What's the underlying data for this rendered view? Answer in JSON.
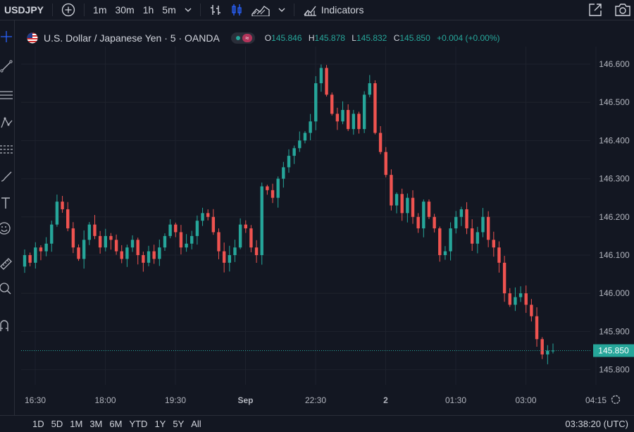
{
  "toolbar": {
    "symbol": "USDJPY",
    "intervals": [
      "1m",
      "30m",
      "1h",
      "5m"
    ],
    "active_interval": "5m",
    "indicators_label": "Indicators"
  },
  "legend": {
    "title": "U.S. Dollar / Japanese Yen · 5 · OANDA",
    "open_key": "O",
    "open": "145.846",
    "high_key": "H",
    "high": "145.878",
    "low_key": "L",
    "low": "145.832",
    "close_key": "C",
    "close": "145.850",
    "change": "+0.004 (+0.00%)"
  },
  "bottom": {
    "ranges": [
      "1D",
      "5D",
      "1M",
      "3M",
      "6M",
      "YTD",
      "1Y",
      "5Y",
      "All"
    ],
    "clock": "03:38:20 (UTC)"
  },
  "colors": {
    "up": "#26a69a",
    "down": "#ef5350",
    "background": "#131722",
    "grid": "#1e222d",
    "text": "#b2b5be",
    "interval_active": "#2962ff"
  },
  "icons": [
    "plus-circle-icon",
    "chevron-down-icon",
    "bar-style-icon",
    "candles-icon",
    "area-chart-icon",
    "indicators-icon",
    "snapshot-icon",
    "camera-icon",
    "crosshair-icon",
    "trend-line-icon",
    "fib-icon",
    "pattern-icon",
    "measure-icon",
    "text-icon",
    "emoji-icon",
    "ruler-icon",
    "zoom-icon",
    "magnet-icon",
    "settings-icon",
    "us-flag-icon"
  ],
  "chart_data": {
    "type": "candlestick",
    "y_ticks": [
      "146.600",
      "146.500",
      "146.400",
      "146.300",
      "146.200",
      "146.100",
      "146.000",
      "145.900",
      "145.800"
    ],
    "x_ticks": [
      "16:30",
      "18:00",
      "19:30",
      "Sep",
      "22:30",
      "2",
      "01:30",
      "03:00",
      "04:15"
    ],
    "last_price": "145.850",
    "ylim": [
      145.75,
      146.67
    ],
    "close_path": [
      146.1,
      146.08,
      146.12,
      146.11,
      146.13,
      146.18,
      146.24,
      146.22,
      146.17,
      146.12,
      146.09,
      146.14,
      146.18,
      146.15,
      146.12,
      146.15,
      146.14,
      146.11,
      146.09,
      146.12,
      146.14,
      146.1,
      146.08,
      146.11,
      146.09,
      146.12,
      146.15,
      146.18,
      146.16,
      146.12,
      146.13,
      146.15,
      146.19,
      146.21,
      146.2,
      146.16,
      146.11,
      146.08,
      146.1,
      146.12,
      146.18,
      146.17,
      146.12,
      146.1,
      146.28,
      146.27,
      146.25,
      146.3,
      146.33,
      146.36,
      146.38,
      146.4,
      146.42,
      146.45,
      146.55,
      146.59,
      146.52,
      146.47,
      146.45,
      146.48,
      146.43,
      146.47,
      146.43,
      146.52,
      146.55,
      146.42,
      146.37,
      146.31,
      146.23,
      146.26,
      146.21,
      146.25,
      146.2,
      146.17,
      146.24,
      146.2,
      146.17,
      146.1,
      146.11,
      146.17,
      146.2,
      146.22,
      146.17,
      146.13,
      146.16,
      146.2,
      146.14,
      146.12,
      146.08,
      146.0,
      145.97,
      145.99,
      146.0,
      145.97,
      145.94,
      145.88,
      145.84,
      145.85,
      145.85
    ]
  }
}
